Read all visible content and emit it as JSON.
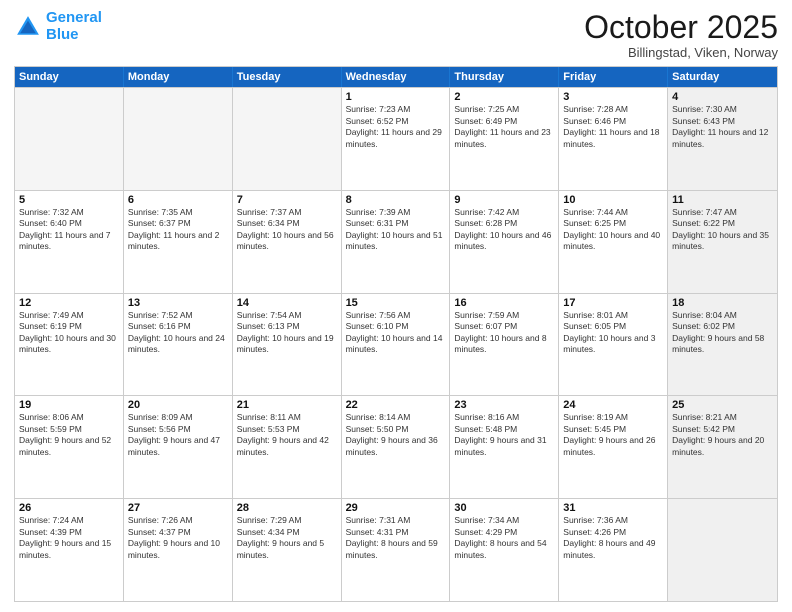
{
  "header": {
    "logo_line1": "General",
    "logo_line2": "Blue",
    "month": "October 2025",
    "location": "Billingstad, Viken, Norway"
  },
  "weekdays": [
    "Sunday",
    "Monday",
    "Tuesday",
    "Wednesday",
    "Thursday",
    "Friday",
    "Saturday"
  ],
  "rows": [
    [
      {
        "day": "",
        "sunrise": "",
        "sunset": "",
        "daylight": "",
        "empty": true
      },
      {
        "day": "",
        "sunrise": "",
        "sunset": "",
        "daylight": "",
        "empty": true
      },
      {
        "day": "",
        "sunrise": "",
        "sunset": "",
        "daylight": "",
        "empty": true
      },
      {
        "day": "1",
        "sunrise": "Sunrise: 7:23 AM",
        "sunset": "Sunset: 6:52 PM",
        "daylight": "Daylight: 11 hours and 29 minutes."
      },
      {
        "day": "2",
        "sunrise": "Sunrise: 7:25 AM",
        "sunset": "Sunset: 6:49 PM",
        "daylight": "Daylight: 11 hours and 23 minutes."
      },
      {
        "day": "3",
        "sunrise": "Sunrise: 7:28 AM",
        "sunset": "Sunset: 6:46 PM",
        "daylight": "Daylight: 11 hours and 18 minutes."
      },
      {
        "day": "4",
        "sunrise": "Sunrise: 7:30 AM",
        "sunset": "Sunset: 6:43 PM",
        "daylight": "Daylight: 11 hours and 12 minutes.",
        "shaded": true
      }
    ],
    [
      {
        "day": "5",
        "sunrise": "Sunrise: 7:32 AM",
        "sunset": "Sunset: 6:40 PM",
        "daylight": "Daylight: 11 hours and 7 minutes."
      },
      {
        "day": "6",
        "sunrise": "Sunrise: 7:35 AM",
        "sunset": "Sunset: 6:37 PM",
        "daylight": "Daylight: 11 hours and 2 minutes."
      },
      {
        "day": "7",
        "sunrise": "Sunrise: 7:37 AM",
        "sunset": "Sunset: 6:34 PM",
        "daylight": "Daylight: 10 hours and 56 minutes."
      },
      {
        "day": "8",
        "sunrise": "Sunrise: 7:39 AM",
        "sunset": "Sunset: 6:31 PM",
        "daylight": "Daylight: 10 hours and 51 minutes."
      },
      {
        "day": "9",
        "sunrise": "Sunrise: 7:42 AM",
        "sunset": "Sunset: 6:28 PM",
        "daylight": "Daylight: 10 hours and 46 minutes."
      },
      {
        "day": "10",
        "sunrise": "Sunrise: 7:44 AM",
        "sunset": "Sunset: 6:25 PM",
        "daylight": "Daylight: 10 hours and 40 minutes."
      },
      {
        "day": "11",
        "sunrise": "Sunrise: 7:47 AM",
        "sunset": "Sunset: 6:22 PM",
        "daylight": "Daylight: 10 hours and 35 minutes.",
        "shaded": true
      }
    ],
    [
      {
        "day": "12",
        "sunrise": "Sunrise: 7:49 AM",
        "sunset": "Sunset: 6:19 PM",
        "daylight": "Daylight: 10 hours and 30 minutes."
      },
      {
        "day": "13",
        "sunrise": "Sunrise: 7:52 AM",
        "sunset": "Sunset: 6:16 PM",
        "daylight": "Daylight: 10 hours and 24 minutes."
      },
      {
        "day": "14",
        "sunrise": "Sunrise: 7:54 AM",
        "sunset": "Sunset: 6:13 PM",
        "daylight": "Daylight: 10 hours and 19 minutes."
      },
      {
        "day": "15",
        "sunrise": "Sunrise: 7:56 AM",
        "sunset": "Sunset: 6:10 PM",
        "daylight": "Daylight: 10 hours and 14 minutes."
      },
      {
        "day": "16",
        "sunrise": "Sunrise: 7:59 AM",
        "sunset": "Sunset: 6:07 PM",
        "daylight": "Daylight: 10 hours and 8 minutes."
      },
      {
        "day": "17",
        "sunrise": "Sunrise: 8:01 AM",
        "sunset": "Sunset: 6:05 PM",
        "daylight": "Daylight: 10 hours and 3 minutes."
      },
      {
        "day": "18",
        "sunrise": "Sunrise: 8:04 AM",
        "sunset": "Sunset: 6:02 PM",
        "daylight": "Daylight: 9 hours and 58 minutes.",
        "shaded": true
      }
    ],
    [
      {
        "day": "19",
        "sunrise": "Sunrise: 8:06 AM",
        "sunset": "Sunset: 5:59 PM",
        "daylight": "Daylight: 9 hours and 52 minutes."
      },
      {
        "day": "20",
        "sunrise": "Sunrise: 8:09 AM",
        "sunset": "Sunset: 5:56 PM",
        "daylight": "Daylight: 9 hours and 47 minutes."
      },
      {
        "day": "21",
        "sunrise": "Sunrise: 8:11 AM",
        "sunset": "Sunset: 5:53 PM",
        "daylight": "Daylight: 9 hours and 42 minutes."
      },
      {
        "day": "22",
        "sunrise": "Sunrise: 8:14 AM",
        "sunset": "Sunset: 5:50 PM",
        "daylight": "Daylight: 9 hours and 36 minutes."
      },
      {
        "day": "23",
        "sunrise": "Sunrise: 8:16 AM",
        "sunset": "Sunset: 5:48 PM",
        "daylight": "Daylight: 9 hours and 31 minutes."
      },
      {
        "day": "24",
        "sunrise": "Sunrise: 8:19 AM",
        "sunset": "Sunset: 5:45 PM",
        "daylight": "Daylight: 9 hours and 26 minutes."
      },
      {
        "day": "25",
        "sunrise": "Sunrise: 8:21 AM",
        "sunset": "Sunset: 5:42 PM",
        "daylight": "Daylight: 9 hours and 20 minutes.",
        "shaded": true
      }
    ],
    [
      {
        "day": "26",
        "sunrise": "Sunrise: 7:24 AM",
        "sunset": "Sunset: 4:39 PM",
        "daylight": "Daylight: 9 hours and 15 minutes."
      },
      {
        "day": "27",
        "sunrise": "Sunrise: 7:26 AM",
        "sunset": "Sunset: 4:37 PM",
        "daylight": "Daylight: 9 hours and 10 minutes."
      },
      {
        "day": "28",
        "sunrise": "Sunrise: 7:29 AM",
        "sunset": "Sunset: 4:34 PM",
        "daylight": "Daylight: 9 hours and 5 minutes."
      },
      {
        "day": "29",
        "sunrise": "Sunrise: 7:31 AM",
        "sunset": "Sunset: 4:31 PM",
        "daylight": "Daylight: 8 hours and 59 minutes."
      },
      {
        "day": "30",
        "sunrise": "Sunrise: 7:34 AM",
        "sunset": "Sunset: 4:29 PM",
        "daylight": "Daylight: 8 hours and 54 minutes."
      },
      {
        "day": "31",
        "sunrise": "Sunrise: 7:36 AM",
        "sunset": "Sunset: 4:26 PM",
        "daylight": "Daylight: 8 hours and 49 minutes."
      },
      {
        "day": "",
        "sunrise": "",
        "sunset": "",
        "daylight": "",
        "empty": true,
        "shaded": true
      }
    ]
  ]
}
